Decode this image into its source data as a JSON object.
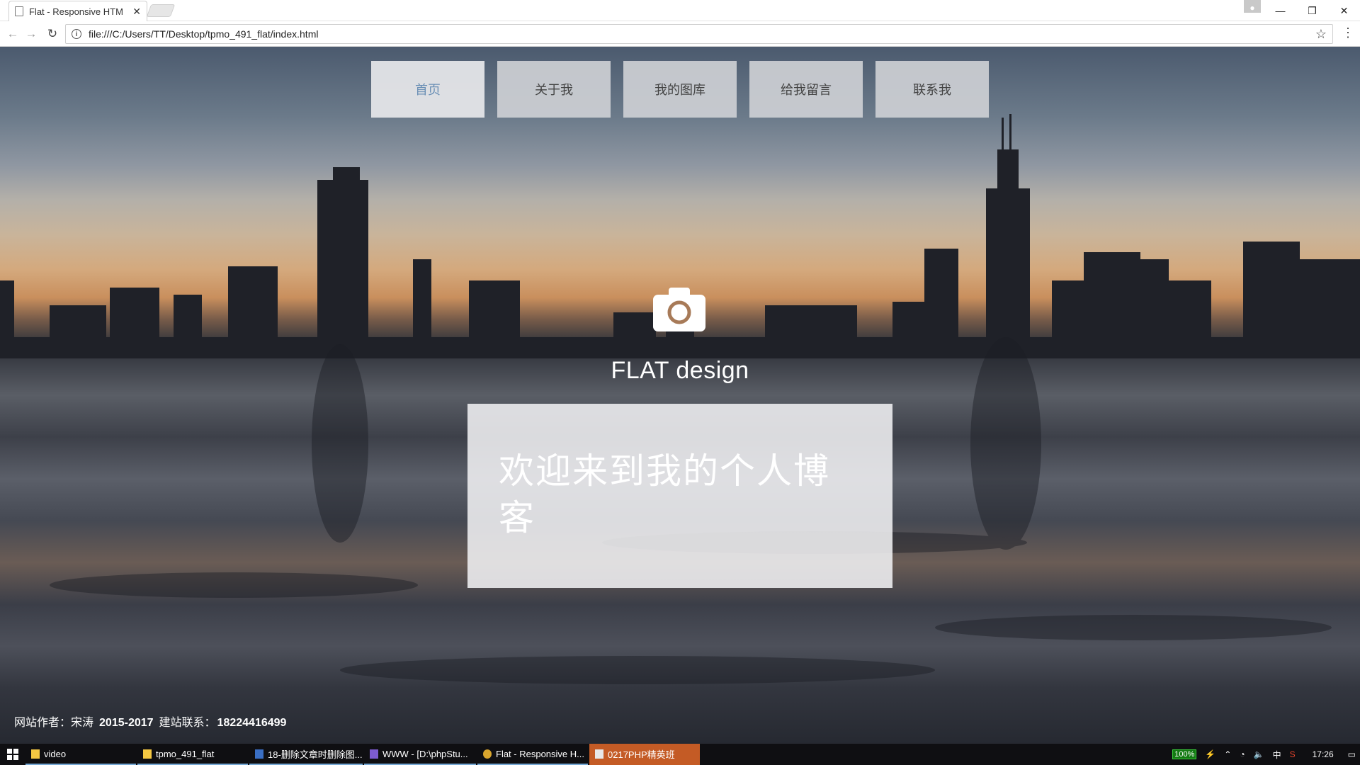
{
  "browser": {
    "tab_title": "Flat - Responsive HTM",
    "tab_close": "✕",
    "url": "file:///C:/Users/TT/Desktop/tpmo_491_flat/index.html",
    "minimize": "—",
    "restore": "❐",
    "close": "✕"
  },
  "page": {
    "nav": [
      {
        "label": "首页",
        "active": true
      },
      {
        "label": "关于我"
      },
      {
        "label": "我的图库"
      },
      {
        "label": "给我留言"
      },
      {
        "label": "联系我"
      }
    ],
    "site_title": "FLAT design",
    "welcome": "欢迎来到我的个人博客",
    "footer": {
      "author_label": "网站作者：宋涛",
      "years": "2015-2017",
      "contact_label": "建站联系：",
      "phone": "18224416499"
    }
  },
  "taskbar": {
    "items": [
      {
        "label": "video",
        "icon": "folder-icon"
      },
      {
        "label": "tpmo_491_flat",
        "icon": "folder-icon"
      },
      {
        "label": "18-删除文章时删除图...",
        "icon": "document-icon"
      },
      {
        "label": "WWW - [D:\\phpStu...",
        "icon": "ide-icon"
      },
      {
        "label": "Flat - Responsive H...",
        "icon": "chrome-icon"
      },
      {
        "label": "0217PHP精英班",
        "icon": "app-icon"
      }
    ],
    "battery": "100%",
    "ime": "中",
    "time": "17:26"
  },
  "colors": {
    "nav_active_text": "#6a8fb5",
    "taskbar_highlight": "#c45b25"
  }
}
